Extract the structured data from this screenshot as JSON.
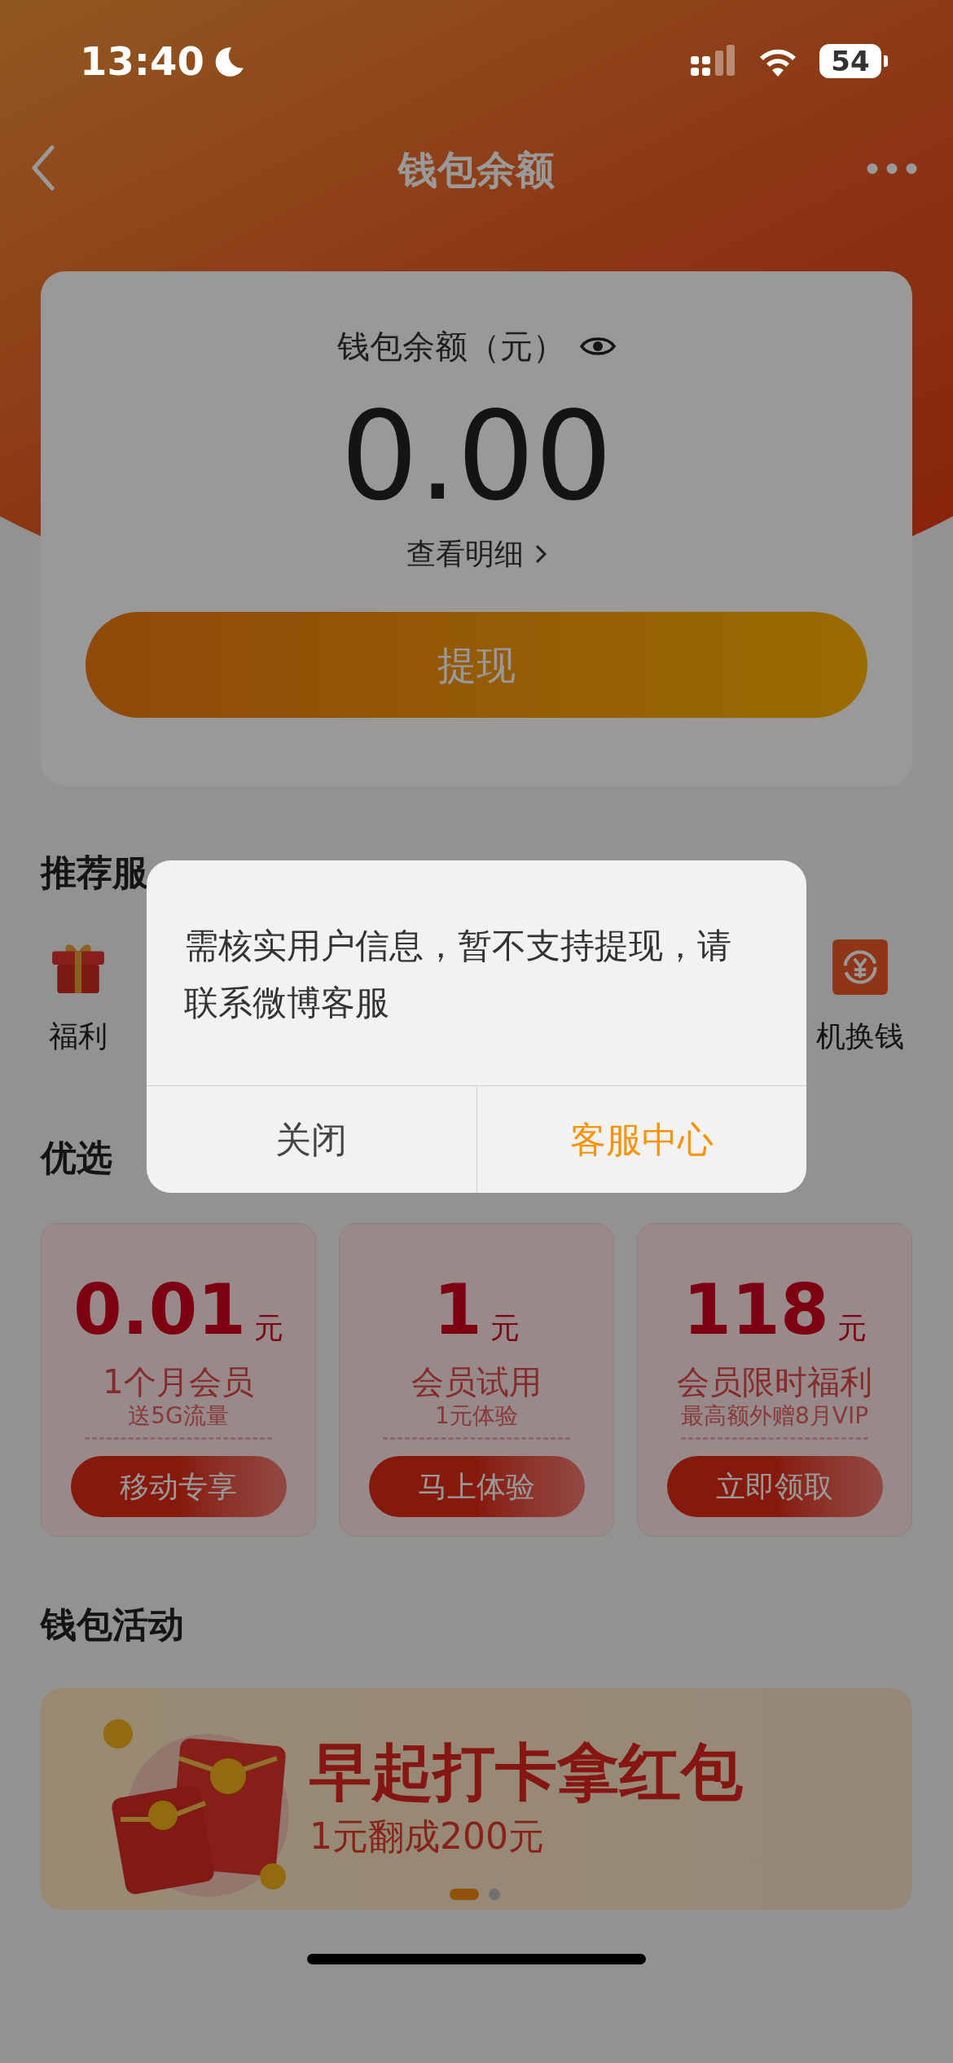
{
  "status_bar": {
    "time": "13:40",
    "battery": "54"
  },
  "nav": {
    "title": "钱包余额"
  },
  "balance": {
    "label": "钱包余额（元）",
    "amount": "0.00",
    "detail_link": "查看明细",
    "withdraw_button": "提现"
  },
  "services": {
    "title": "推荐服",
    "items": [
      {
        "label": "福利",
        "kind": "gift"
      },
      {
        "label": "机换钱",
        "kind": "exchange"
      }
    ]
  },
  "picks": {
    "title": "优选",
    "coupons": [
      {
        "amount": "0.01",
        "unit": "元",
        "title": "1个月会员",
        "subtitle": "送5G流量",
        "button": "移动专享"
      },
      {
        "amount": "1",
        "unit": "元",
        "title": "会员试用",
        "subtitle": "1元体验",
        "button": "马上体验"
      },
      {
        "amount": "118",
        "unit": "元",
        "title": "会员限时福利",
        "subtitle": "最高额外赠8月VIP",
        "button": "立即领取"
      }
    ]
  },
  "activities": {
    "title": "钱包活动",
    "banner": {
      "title": "早起打卡拿红包",
      "subtitle": "1元翻成200元",
      "pages": [
        {
          "selected": true
        },
        {
          "selected": false
        }
      ]
    }
  },
  "dialog": {
    "message": "需核实用户信息，暂不支持提现，请联系微博客服",
    "buttons": [
      {
        "label": "关闭",
        "kind": "cancel"
      },
      {
        "label": "客服中心",
        "kind": "primary"
      }
    ]
  }
}
